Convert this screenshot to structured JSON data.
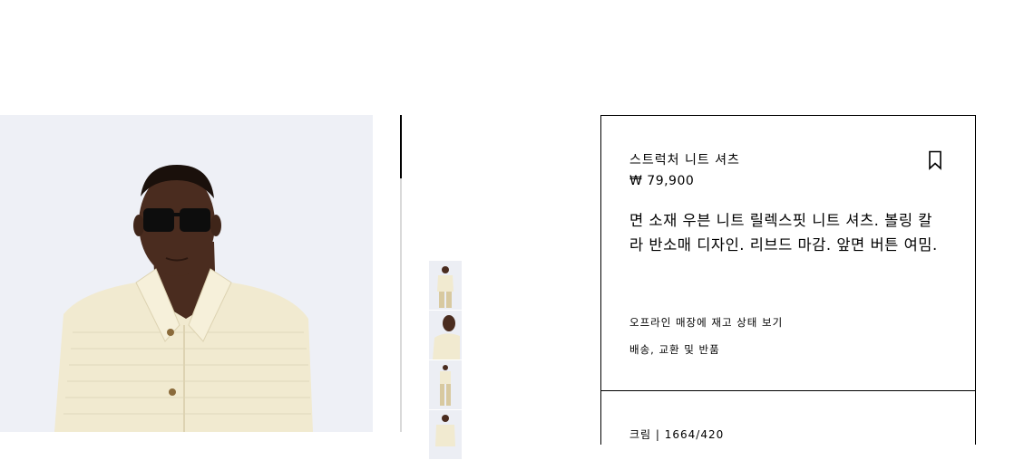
{
  "product": {
    "name": "스트럭처 니트 셔츠",
    "price": "₩ 79,900",
    "description": "면 소재 우븐 니트 릴렉스핏 니트 셔츠. 볼링 칼라 반소매 디자인. 리브드 마감. 앞면 버튼 여밈.",
    "store_stock_link": "오프라인 매장에 재고 상태 보기",
    "shipping_link": "배송, 교환 및 반품",
    "colour_line": "크림 | 1664/420"
  },
  "gallery": {
    "thumbnail_count": 4
  },
  "icons": {
    "bookmark": "bookmark-icon"
  },
  "colors": {
    "background": "#ffffff",
    "photo_background": "#eef0f6",
    "shirt": "#f1ead0",
    "border": "#000000"
  }
}
